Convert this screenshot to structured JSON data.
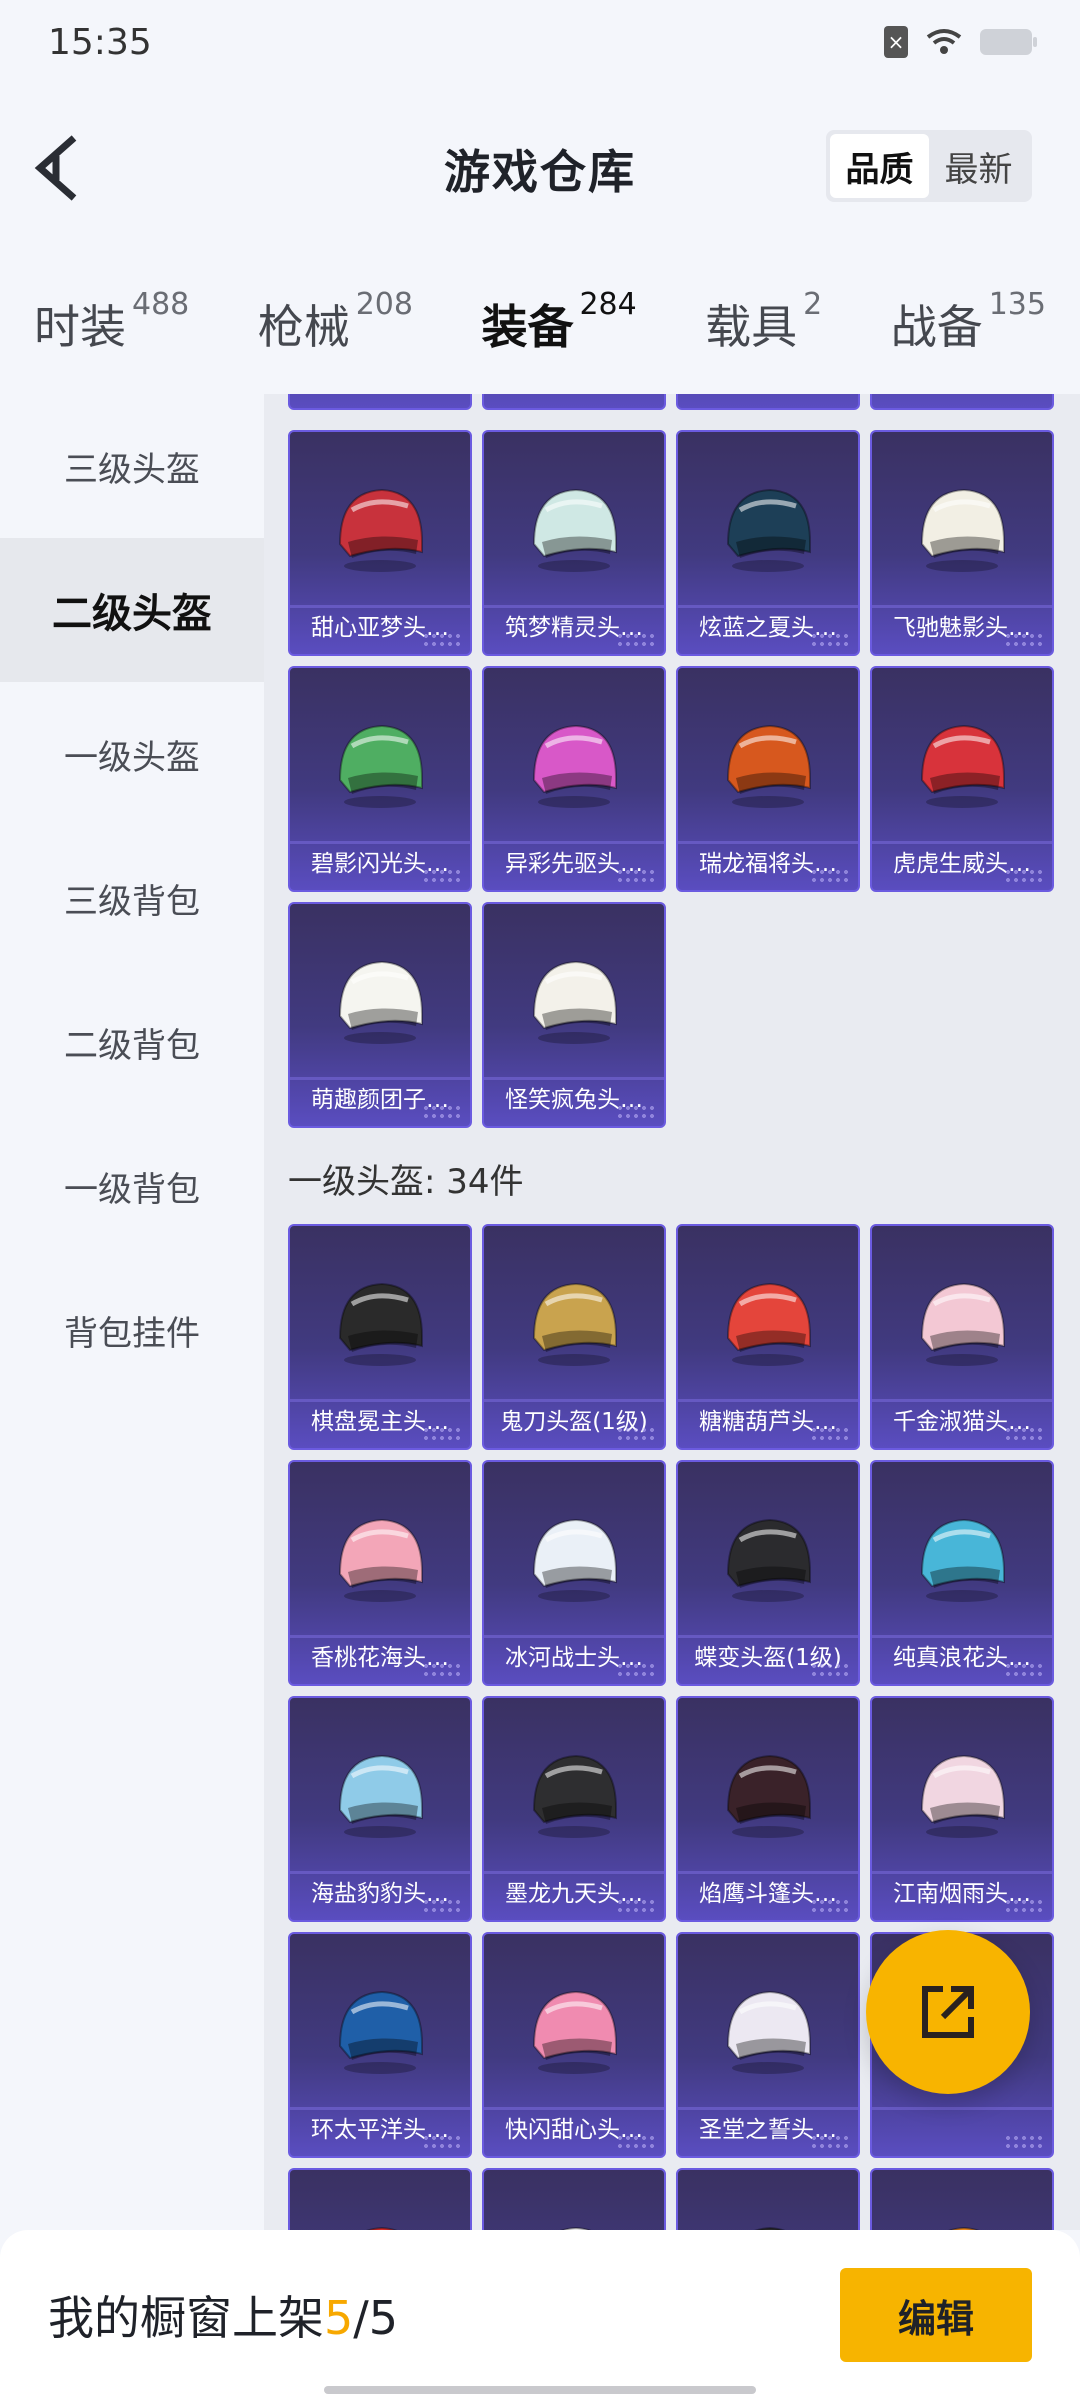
{
  "status": {
    "time": "15:35"
  },
  "header": {
    "title": "游戏仓库",
    "sort_options": [
      "品质",
      "最新"
    ],
    "active_sort": "品质"
  },
  "tabs": [
    {
      "label": "时装",
      "count": "488"
    },
    {
      "label": "枪械",
      "count": "208"
    },
    {
      "label": "装备",
      "count": "284",
      "active": true
    },
    {
      "label": "载具",
      "count": "2"
    },
    {
      "label": "战备",
      "count": "135"
    }
  ],
  "sidebar": [
    "三级头盔",
    "二级头盔",
    "一级头盔",
    "三级背包",
    "二级背包",
    "一级背包",
    "背包挂件"
  ],
  "sidebar_active": "二级头盔",
  "level2_items": [
    {
      "name": "甜心亚梦头…",
      "color": "#c8323c"
    },
    {
      "name": "筑梦精灵头…",
      "color": "#cfe8e4"
    },
    {
      "name": "炫蓝之夏头…",
      "color": "#1d3f57"
    },
    {
      "name": "飞驰魅影头…",
      "color": "#f2efe4"
    },
    {
      "name": "碧影闪光头…",
      "color": "#4fae62"
    },
    {
      "name": "异彩先驱头…",
      "color": "#d858c8"
    },
    {
      "name": "瑞龙福将头…",
      "color": "#d7581e"
    },
    {
      "name": "虎虎生威头…",
      "color": "#d8333b"
    },
    {
      "name": "萌趣颜团子…",
      "color": "#f5f5f0"
    },
    {
      "name": "怪笑疯兔头…",
      "color": "#f3f1ea"
    }
  ],
  "level1_section": "一级头盔: 34件",
  "level1_items": [
    {
      "name": "棋盘冕主头…",
      "color": "#2a2a2a"
    },
    {
      "name": "鬼刀头盔(1级)",
      "color": "#c9a34e"
    },
    {
      "name": "糖糖葫芦头…",
      "color": "#e4453b"
    },
    {
      "name": "千金淑猫头…",
      "color": "#f3c8d4"
    },
    {
      "name": "香桃花海头…",
      "color": "#f3a6b8"
    },
    {
      "name": "冰河战士头…",
      "color": "#eaf0f7"
    },
    {
      "name": "蝶变头盔(1级)",
      "color": "#2b2b2e"
    },
    {
      "name": "纯真浪花头…",
      "color": "#48b6d8"
    },
    {
      "name": "海盐豹豹头…",
      "color": "#8fcbe8"
    },
    {
      "name": "墨龙九天头…",
      "color": "#2e2e30"
    },
    {
      "name": "焰鹰斗篷头…",
      "color": "#3a2229"
    },
    {
      "name": "江南烟雨头…",
      "color": "#f1d6e1"
    },
    {
      "name": "环太平洋头…",
      "color": "#1f5fa8"
    },
    {
      "name": "快闪甜心头…",
      "color": "#f08bb0"
    },
    {
      "name": "圣堂之誓头…",
      "color": "#ece8f2"
    },
    {
      "name": "",
      "color": "#f6f4ea"
    },
    {
      "name": "",
      "color": "#d92b2b"
    },
    {
      "name": "",
      "color": "#eeeeee"
    },
    {
      "name": "",
      "color": "#2a2a2c"
    },
    {
      "name": "",
      "color": "#f08a20"
    }
  ],
  "bottom": {
    "label_prefix": "我的橱窗上架",
    "count": "5",
    "total": "/5",
    "edit": "编辑"
  }
}
